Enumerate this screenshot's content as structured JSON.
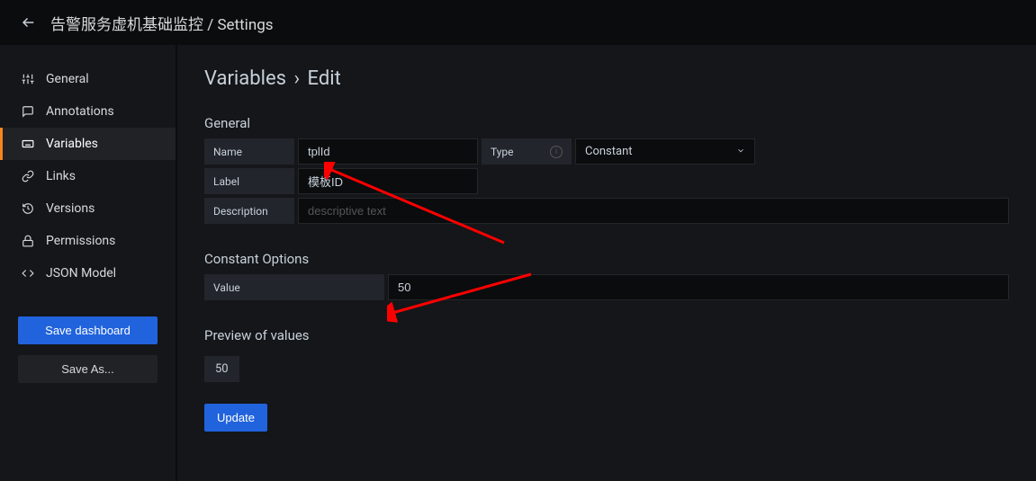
{
  "header": {
    "breadcrumb": "告警服务虚机基础监控 / Settings"
  },
  "sidebar": {
    "items": [
      {
        "key": "general",
        "label": "General"
      },
      {
        "key": "annotations",
        "label": "Annotations"
      },
      {
        "key": "variables",
        "label": "Variables"
      },
      {
        "key": "links",
        "label": "Links"
      },
      {
        "key": "versions",
        "label": "Versions"
      },
      {
        "key": "permissions",
        "label": "Permissions"
      },
      {
        "key": "json-model",
        "label": "JSON Model"
      }
    ],
    "save_label": "Save dashboard",
    "save_as_label": "Save As..."
  },
  "content": {
    "title_1": "Variables",
    "title_2": "Edit",
    "section_general": "General",
    "label_name": "Name",
    "value_name": "tplId",
    "label_type": "Type",
    "value_type": "Constant",
    "label_label": "Label",
    "value_label": "模板ID",
    "label_description": "Description",
    "placeholder_description": "descriptive text",
    "section_constant": "Constant Options",
    "label_value": "Value",
    "value_value": "50",
    "section_preview": "Preview of values",
    "preview_value": "50",
    "update_label": "Update"
  }
}
